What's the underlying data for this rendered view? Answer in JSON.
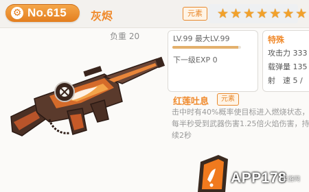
{
  "header": {
    "number": "No.615",
    "name": "灰烬",
    "element_tag": "元素",
    "stars": 7,
    "star_glyph": "★",
    "gear_glyph": "⚙"
  },
  "weapon": {
    "load": "负重 20",
    "image_icon": "flame-rifle"
  },
  "level": {
    "text": "LV.99 最大LV.99",
    "exp_progress": 0.96,
    "next_exp": "下一级EXP 0"
  },
  "special": {
    "title": "特殊",
    "stats": [
      {
        "label": "攻击力",
        "value": "333"
      },
      {
        "label": "载弹量",
        "value": "135"
      },
      {
        "label": "射　速",
        "value": "5 /"
      }
    ]
  },
  "skill": {
    "title": "红莲吐息",
    "tag": "元素",
    "description": "击中时有40%概率使目标进入燃烧状态，每半秒受到武器伤害1.25倍火焰伤害，持续2秒"
  },
  "watermark": {
    "text": "APP178",
    "sub": "手游网",
    "logo_icon": "phone-logo"
  },
  "colors": {
    "accent": "#f08a2c",
    "badge": "#e37e1f",
    "star": "#f2a12a"
  }
}
